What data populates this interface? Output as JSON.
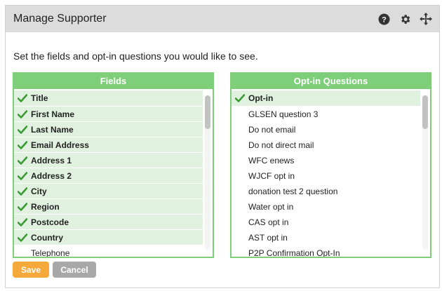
{
  "dialog": {
    "title": "Manage Supporter"
  },
  "header_icons": [
    "help-icon",
    "gear-icon",
    "move-icon"
  ],
  "intro": "Set the fields and opt-in questions you would like to see.",
  "fields_panel": {
    "heading": "Fields",
    "items": [
      {
        "label": "Title",
        "checked": true
      },
      {
        "label": "First Name",
        "checked": true
      },
      {
        "label": "Last Name",
        "checked": true
      },
      {
        "label": "Email Address",
        "checked": true
      },
      {
        "label": "Address 1",
        "checked": true
      },
      {
        "label": "Address 2",
        "checked": true
      },
      {
        "label": "City",
        "checked": true
      },
      {
        "label": "Region",
        "checked": true
      },
      {
        "label": "Postcode",
        "checked": true
      },
      {
        "label": "Country",
        "checked": true
      },
      {
        "label": "Telephone",
        "checked": false
      }
    ]
  },
  "optin_panel": {
    "heading": "Opt-in Questions",
    "items": [
      {
        "label": "Opt-in",
        "checked": true
      },
      {
        "label": "GLSEN question 3",
        "checked": false
      },
      {
        "label": "Do not email",
        "checked": false
      },
      {
        "label": "Do not direct mail",
        "checked": false
      },
      {
        "label": "WFC enews",
        "checked": false
      },
      {
        "label": "WJCF opt in",
        "checked": false
      },
      {
        "label": "donation test 2 question",
        "checked": false
      },
      {
        "label": "Water opt in",
        "checked": false
      },
      {
        "label": "CAS opt in",
        "checked": false
      },
      {
        "label": "AST opt in",
        "checked": false
      },
      {
        "label": "P2P Confirmation Opt-In",
        "checked": false
      }
    ]
  },
  "buttons": {
    "save": "Save",
    "cancel": "Cancel"
  },
  "colors": {
    "header_bg": "#dcdcdc",
    "panel_green": "#7fcf7a",
    "checked_row": "#e0f2df",
    "check_mark": "#3a9a33",
    "save": "#f5a93a",
    "cancel": "#a8a8a8"
  }
}
